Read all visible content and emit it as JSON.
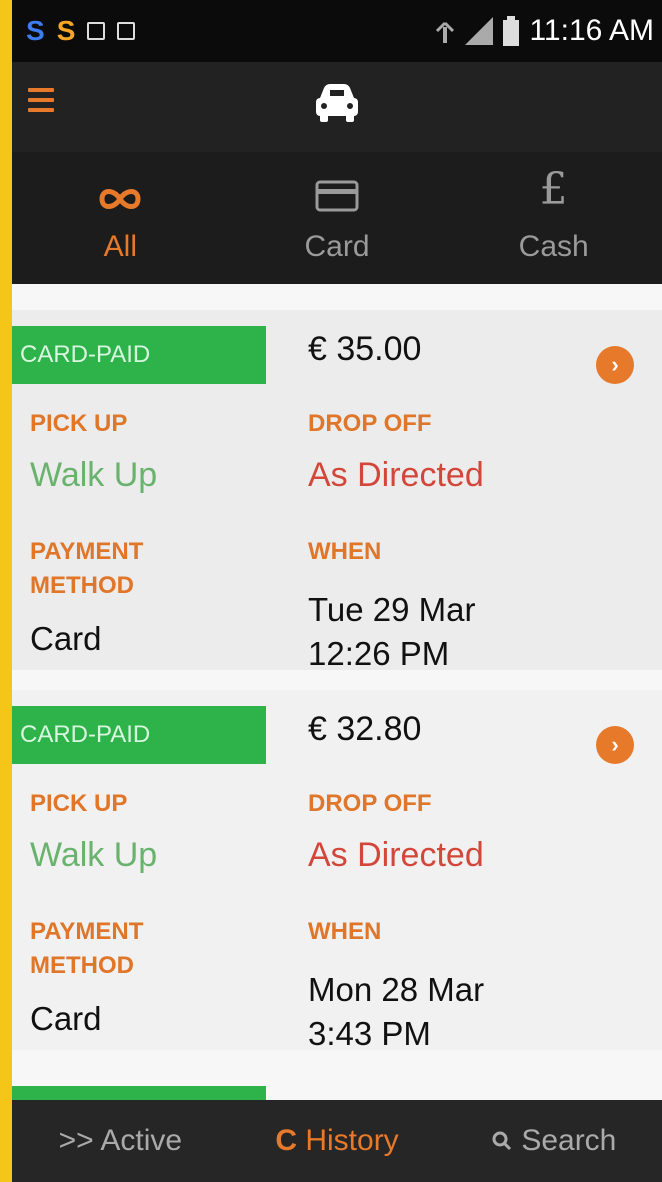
{
  "status_bar": {
    "time": "11:16 AM"
  },
  "filters": [
    {
      "label": "All",
      "icon": "infinity-icon",
      "active": true
    },
    {
      "label": "Card",
      "icon": "credit-card-icon",
      "active": false
    },
    {
      "label": "Cash",
      "icon": "pound-icon",
      "active": false
    }
  ],
  "trips": [
    {
      "badge": "CARD-PAID",
      "price": "€ 35.00",
      "pickup_label": "PICK UP",
      "pickup": "Walk Up",
      "dropoff_label": "DROP OFF",
      "dropoff": "As Directed",
      "payment_label_1": "PAYMENT",
      "payment_label_2": "METHOD",
      "payment": "Card",
      "when_label": "WHEN",
      "when_date": "Tue 29 Mar",
      "when_time": "12:26 PM"
    },
    {
      "badge": "CARD-PAID",
      "price": "€ 32.80",
      "pickup_label": "PICK UP",
      "pickup": "Walk Up",
      "dropoff_label": "DROP OFF",
      "dropoff": "As Directed",
      "payment_label_1": "PAYMENT",
      "payment_label_2": "METHOD",
      "payment": "Card",
      "when_label": "WHEN",
      "when_date": "Mon 28 Mar",
      "when_time": "3:43 PM"
    }
  ],
  "bottom_nav": {
    "active": ">> Active",
    "history": "History",
    "search": "Search"
  },
  "colors": {
    "accent": "#e6792a",
    "badge_green": "#2db34a",
    "pickup_green": "#6ab36e",
    "dropoff_red": "#d2473a"
  }
}
